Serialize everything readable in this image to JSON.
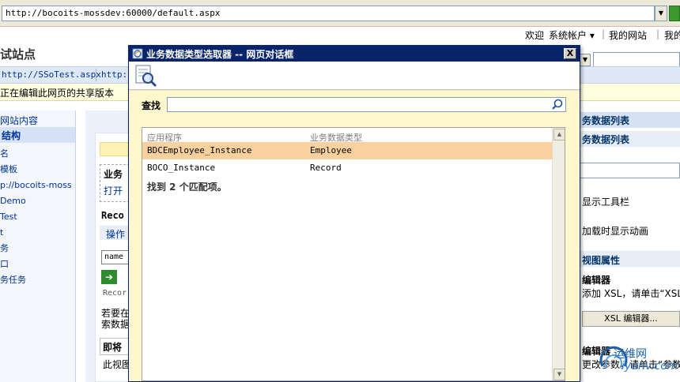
{
  "browser": {
    "address": "http://bocoits-mossdev:60000/default.aspx"
  },
  "topnav": {
    "welcome": "欢迎",
    "account": "系统帐户 ▾",
    "separator1": "|",
    "my_site": "我的网站",
    "separator2": "|",
    "my_links": "我的"
  },
  "site": {
    "title": "试站点"
  },
  "tabrow": {
    "items": [
      "http://SSoTest.aspx",
      "http:/"
    ]
  },
  "infobar": {
    "text": "正在编辑此网页的共享版本"
  },
  "leftnav": {
    "quicklaunch": "网站内容",
    "structure": "结构",
    "items": [
      "名",
      "模板",
      "p://bocoits-moss",
      "Demo",
      "Test",
      "t",
      "务",
      "口",
      "务任务"
    ]
  },
  "center": {
    "webpart1_title": "业务",
    "webpart1_link": "打开",
    "webpart2_title": "Reco",
    "webpart2_action": "操作",
    "input_value": "name",
    "go_arrow": "➔",
    "record_label": "Recor",
    "instruction_line1": "若要在",
    "instruction_line2": "索数据",
    "section_title": "即将",
    "view_text": "此视图"
  },
  "rightpane": {
    "header": "务数据列表",
    "subheader": "务数据列表",
    "toolbar_option": "显示工具栏",
    "animation_option": "加载时显示动画",
    "view_properties": "视图属性",
    "xsl_editor_title": "编辑器",
    "xsl_instruction": "添加 XSL，请单击“XSL",
    "xsl_button": "XSL 编辑器...",
    "param_editor_title": "编辑器",
    "param_instruction": "更改参数，请单击“参数"
  },
  "watermark": {
    "text": "运维网",
    "url": "iyunv.com"
  },
  "dialog": {
    "title": "业务数据类型选取器 -- 网页对话框",
    "close": "X",
    "search_label": "查找",
    "search_value": "",
    "columns": {
      "app": "应用程序",
      "type": "业务数据类型"
    },
    "rows": [
      {
        "app": "BDCEmployee_Instance",
        "type": "Employee",
        "selected": true
      },
      {
        "app": "BOCO_Instance",
        "type": "Record",
        "selected": false
      }
    ],
    "match_count": "找到 2 个匹配项。"
  },
  "colors": {
    "titlebar": "#0a246a",
    "selected_row": "#f9d19e",
    "dialog_body": "#fff8cc",
    "link_blue": "#003399"
  }
}
